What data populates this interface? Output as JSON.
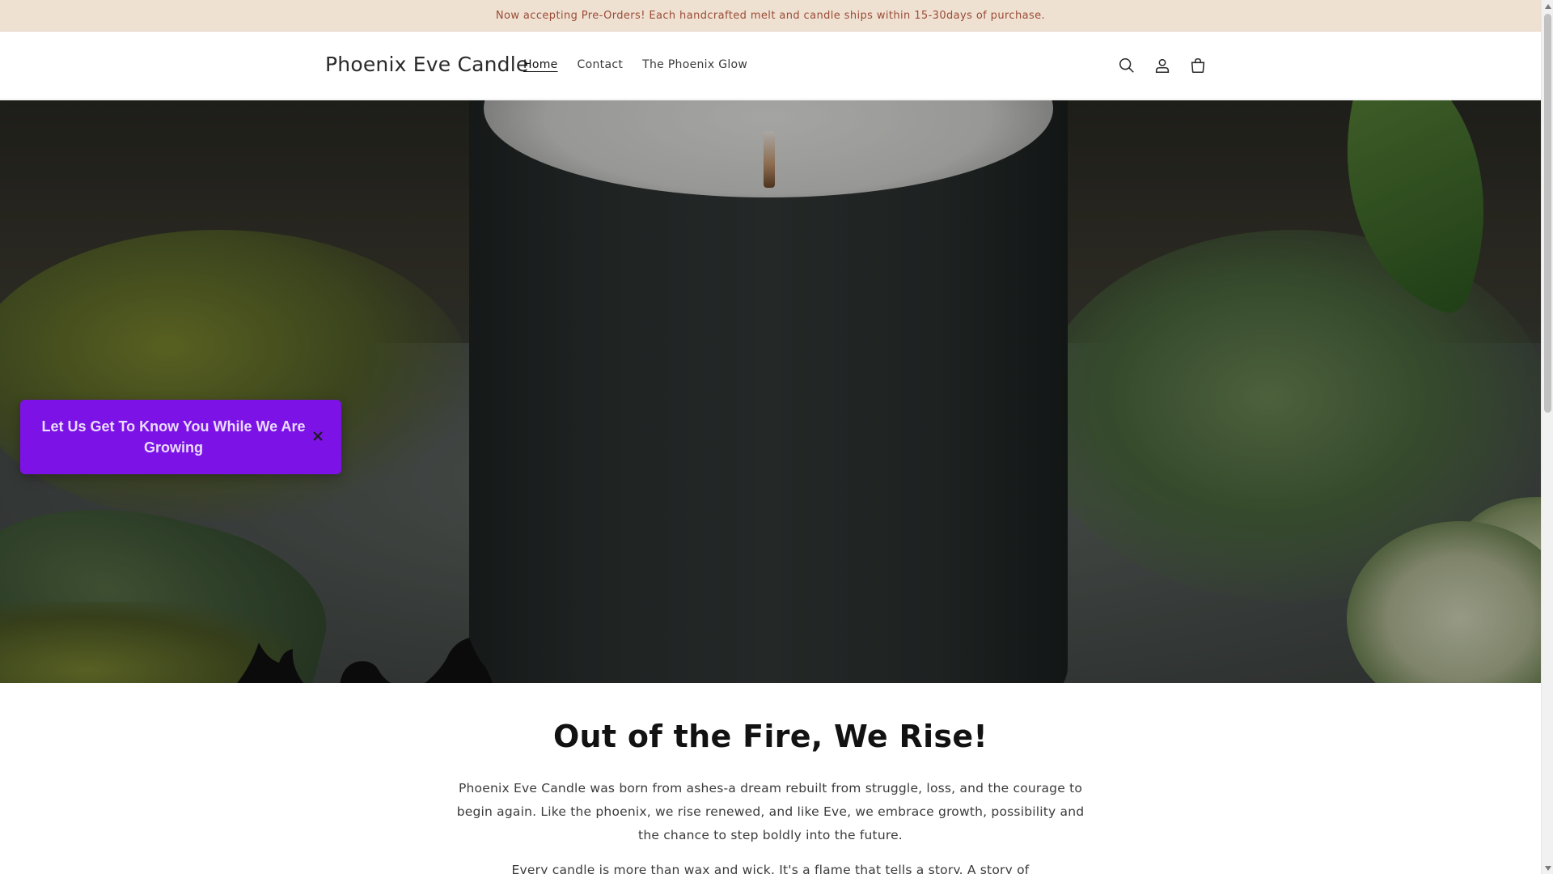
{
  "announcement": {
    "text": "Now accepting Pre-Orders! Each handcrafted melt and candle ships within 15-30days of purchase."
  },
  "header": {
    "brand": "Phoenix Eve Candle",
    "nav": [
      {
        "label": "Home",
        "active": true
      },
      {
        "label": "Contact",
        "active": false
      },
      {
        "label": "The Phoenix Glow",
        "active": false
      }
    ],
    "icons": [
      "search-icon",
      "account-icon",
      "cart-icon"
    ]
  },
  "popup": {
    "text": "Let Us Get To Know You While We Are Growing",
    "color": "#7d12e6"
  },
  "content": {
    "headline": "Out of the Fire, We Rise!",
    "paragraph1": "Phoenix Eve Candle was born from ashes-a dream rebuilt from struggle, loss, and the courage to begin again. Like the phoenix, we rise renewed, and like Eve, we embrace growth, possibility and the chance to step boldly into the future.",
    "paragraph2": "Every candle is more than wax and wick. It's a flame that tells a story. A story of"
  },
  "colors": {
    "announcement_bg": "#efe1d2",
    "announcement_text": "#9a4b36",
    "popup_bg": "#7d12e6"
  }
}
